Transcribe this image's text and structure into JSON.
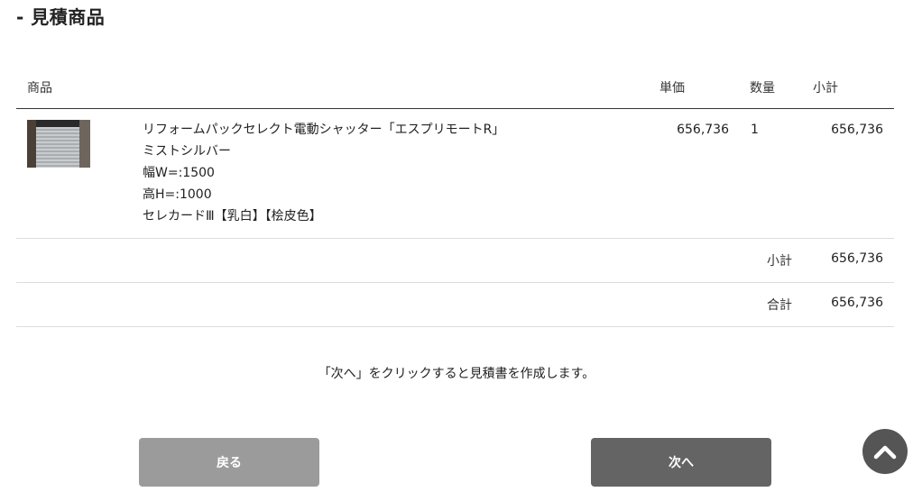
{
  "section": {
    "title": "- 見積商品"
  },
  "table": {
    "headers": {
      "product": "商品",
      "unit_price": "単価",
      "quantity": "数量",
      "subtotal": "小計"
    },
    "items": [
      {
        "lines": [
          "リフォームパックセレクト電動シャッター「エスプリモートR」",
          "ミストシルバー",
          "幅W=:1500",
          "高H=:1000",
          "セレカードⅢ【乳白】【桧皮色】"
        ],
        "unit_price": "656,736",
        "quantity": "1",
        "subtotal": "656,736"
      }
    ],
    "summary": {
      "subtotal_label": "小計",
      "subtotal_value": "656,736",
      "total_label": "合計",
      "total_value": "656,736"
    }
  },
  "notice": "「次へ」をクリックすると見積書を作成します。",
  "buttons": {
    "back": "戻る",
    "next": "次へ"
  },
  "icons": {
    "scroll_top": "chevron-up-icon",
    "product_thumb": "shutter-image"
  }
}
